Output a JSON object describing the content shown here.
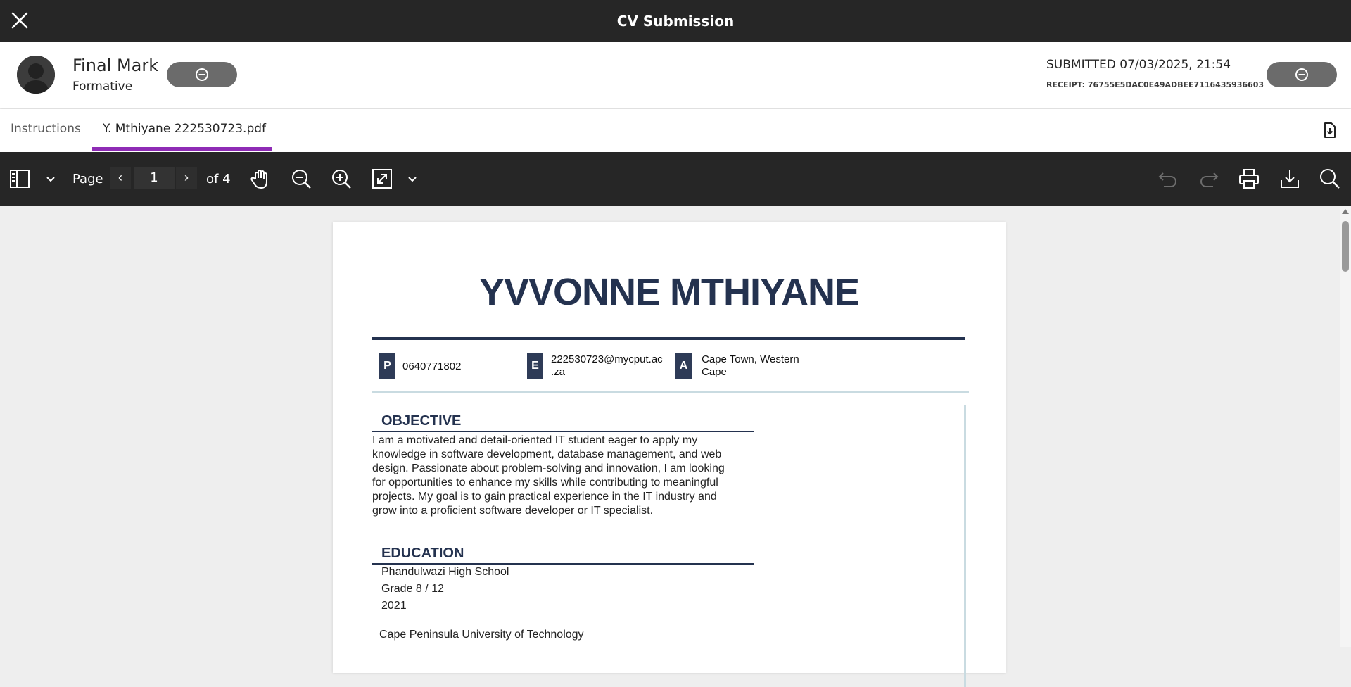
{
  "titlebar": {
    "title": "CV Submission"
  },
  "header": {
    "grade_title": "Final Mark",
    "grade_subtitle": "Formative",
    "submitted": "SUBMITTED 07/03/2025, 21:54",
    "receipt": "RECEIPT: 76755E5DAC0E49ADBEE7116435936603"
  },
  "tabs": [
    {
      "label": "Instructions"
    },
    {
      "label": "Y. Mthiyane 222530723.pdf",
      "active": true
    }
  ],
  "toolbar": {
    "page_label": "Page",
    "current_page": "1",
    "of_label": "of 4",
    "prev": "‹",
    "next": "›"
  },
  "document": {
    "name": "YVVONNE MTHIYANE",
    "contacts": [
      {
        "badge": "P",
        "text": "0640771802"
      },
      {
        "badge": "E",
        "line1": "222530723@mycput.ac",
        "line2": ".za"
      },
      {
        "badge": "A",
        "line1": "Cape Town, Western",
        "line2": "Cape"
      }
    ],
    "objective_title": "OBJECTIVE",
    "objective_lines": [
      "I am a motivated and detail-oriented IT student eager to apply my",
      "knowledge in software development, database management, and web",
      "design. Passionate about problem-solving and innovation, I am looking",
      "for opportunities to enhance my skills while contributing to meaningful",
      "projects. My goal is to gain practical experience in the IT industry and",
      "grow into a proficient software developer or IT specialist."
    ],
    "education_title": "EDUCATION",
    "education": [
      "Phandulwazi High School",
      "Grade 8 / 12",
      "2021",
      "Cape Peninsula University of Technology"
    ]
  },
  "colors": {
    "titlebar": "#262626",
    "tab_accent": "#8e2bb5",
    "cv_heading": "#24324f",
    "pill": "#6b6b6b"
  }
}
